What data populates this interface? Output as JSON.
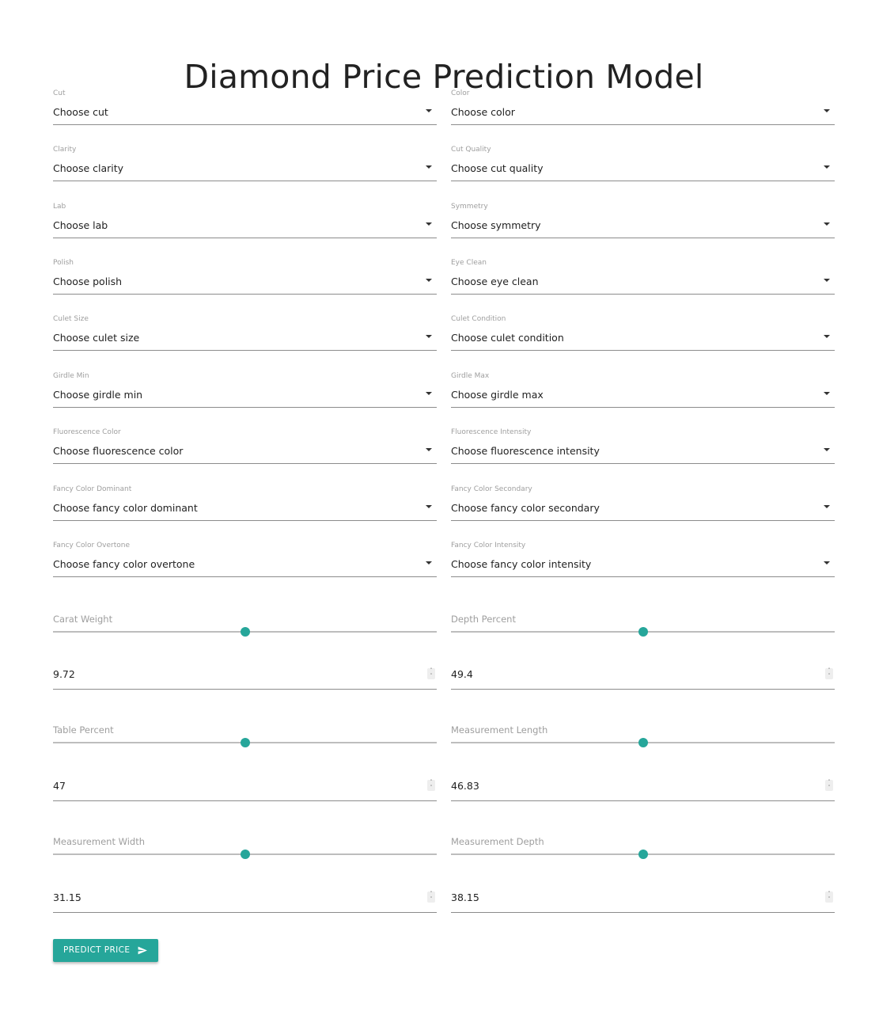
{
  "title": "Diamond Price Prediction Model",
  "selects_left": [
    {
      "label": "Cut",
      "value": "Choose cut"
    },
    {
      "label": "Clarity",
      "value": "Choose clarity"
    },
    {
      "label": "Lab",
      "value": "Choose lab"
    },
    {
      "label": "Polish",
      "value": "Choose polish"
    },
    {
      "label": "Culet Size",
      "value": "Choose culet size"
    },
    {
      "label": "Girdle Min",
      "value": "Choose girdle min"
    },
    {
      "label": "Fluorescence Color",
      "value": "Choose fluorescence color"
    },
    {
      "label": "Fancy Color Dominant",
      "value": "Choose fancy color dominant"
    },
    {
      "label": "Fancy Color Overtone",
      "value": "Choose fancy color overtone"
    }
  ],
  "selects_right": [
    {
      "label": "Color",
      "value": "Choose color"
    },
    {
      "label": "Cut Quality",
      "value": "Choose cut quality"
    },
    {
      "label": "Symmetry",
      "value": "Choose symmetry"
    },
    {
      "label": "Eye Clean",
      "value": "Choose eye clean"
    },
    {
      "label": "Culet Condition",
      "value": "Choose culet condition"
    },
    {
      "label": "Girdle Max",
      "value": "Choose girdle max"
    },
    {
      "label": "Fluorescence Intensity",
      "value": "Choose fluorescence intensity"
    },
    {
      "label": "Fancy Color Secondary",
      "value": "Choose fancy color secondary"
    },
    {
      "label": "Fancy Color Intensity",
      "value": "Choose fancy color intensity"
    }
  ],
  "sliders_left": [
    {
      "label": "Carat Weight",
      "value": "9.72",
      "level": 0.5
    },
    {
      "label": "Table Percent",
      "value": "47",
      "level": 0.5
    },
    {
      "label": "Measurement Width",
      "value": "31.15",
      "level": 0.5
    }
  ],
  "sliders_right": [
    {
      "label": "Depth Percent",
      "value": "49.4",
      "level": 0.5
    },
    {
      "label": "Measurement Length",
      "value": "46.83",
      "level": 0.5
    },
    {
      "label": "Measurement Depth",
      "value": "38.15",
      "level": 0.5
    }
  ],
  "predict_button": {
    "label": "PREDICT PRICE",
    "icon": "send-icon"
  },
  "accent_color": "#26a69a"
}
